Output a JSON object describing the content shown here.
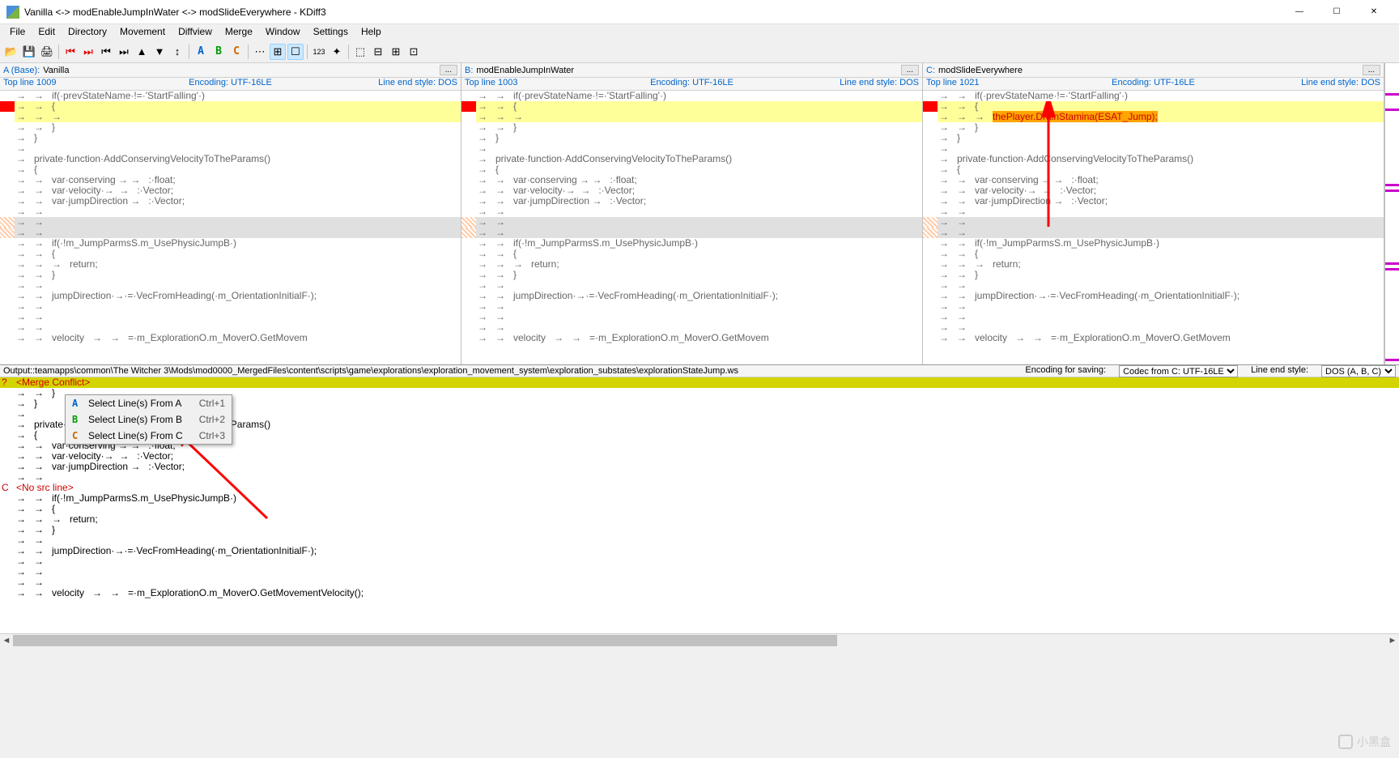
{
  "title": "Vanilla <-> modEnableJumpInWater <-> modSlideEverywhere - KDiff3",
  "menu": [
    "File",
    "Edit",
    "Directory",
    "Movement",
    "Diffview",
    "Merge",
    "Window",
    "Settings",
    "Help"
  ],
  "toolbar_icons": [
    "open",
    "save",
    "print",
    "|",
    "nav1",
    "nav2",
    "nav3",
    "nav4",
    "nav5",
    "nav6",
    "nav7",
    "|",
    "A",
    "B",
    "C",
    "|",
    "toggle1",
    "toggle2",
    "toggle3",
    "|",
    "123",
    "split",
    "|",
    "cfg1",
    "cfg2",
    "cfg3",
    "cfg4"
  ],
  "panes": {
    "A": {
      "label": "A (Base):",
      "name": "Vanilla",
      "topline": "Top line 1009",
      "encoding": "Encoding: UTF-16LE",
      "lineend": "Line end style: DOS"
    },
    "B": {
      "label": "B:",
      "name": "modEnableJumpInWater",
      "topline": "Top line 1003",
      "encoding": "Encoding: UTF-16LE",
      "lineend": "Line end style: DOS"
    },
    "C": {
      "label": "C:",
      "name": "modSlideEverywhere",
      "topline": "Top line 1021",
      "encoding": "Encoding: UTF-16LE",
      "lineend": "Line end style: DOS"
    }
  },
  "codeA": [
    {
      "g": "",
      "c": "→   →   if(·prevStateName·!=·'StartFalling'·)",
      "cls": ""
    },
    {
      "g": "red",
      "c": "→   →   {",
      "cls": "hl-yellow"
    },
    {
      "g": "",
      "c": "→   →   →   ",
      "cls": "hl-yellow"
    },
    {
      "g": "",
      "c": "→   →   }",
      "cls": ""
    },
    {
      "g": "",
      "c": "→   }",
      "cls": ""
    },
    {
      "g": "",
      "c": "→   ",
      "cls": ""
    },
    {
      "g": "",
      "c": "→   private·function·AddConservingVelocityToTheParams()",
      "cls": ""
    },
    {
      "g": "",
      "c": "→   {",
      "cls": ""
    },
    {
      "g": "",
      "c": "→   →   var·conserving → →   :·float;",
      "cls": ""
    },
    {
      "g": "",
      "c": "→   →   var·velocity·→  →   :·Vector;",
      "cls": ""
    },
    {
      "g": "",
      "c": "→   →   var·jumpDirection →   :·Vector;",
      "cls": ""
    },
    {
      "g": "",
      "c": "→   →   ",
      "cls": ""
    },
    {
      "g": "hatch",
      "c": "→   →   ",
      "cls": "hl-gray"
    },
    {
      "g": "hatch",
      "c": "→   →   ",
      "cls": "hl-gray"
    },
    {
      "g": "",
      "c": "→   →   if(·!m_JumpParmsS.m_UsePhysicJumpB·)",
      "cls": ""
    },
    {
      "g": "",
      "c": "→   →   {",
      "cls": ""
    },
    {
      "g": "",
      "c": "→   →   →   return;",
      "cls": ""
    },
    {
      "g": "",
      "c": "→   →   }",
      "cls": ""
    },
    {
      "g": "",
      "c": "→   →   ",
      "cls": ""
    },
    {
      "g": "",
      "c": "→   →   jumpDirection·→·=·VecFromHeading(·m_OrientationInitialF·);",
      "cls": ""
    },
    {
      "g": "",
      "c": "→   →   ",
      "cls": ""
    },
    {
      "g": "",
      "c": "→   →   ",
      "cls": ""
    },
    {
      "g": "",
      "c": "→   →   ",
      "cls": ""
    },
    {
      "g": "",
      "c": "→   →   velocity   →   →   =·m_ExplorationO.m_MoverO.GetMovem",
      "cls": ""
    }
  ],
  "codeC_highlight": "thePlayer.DrainStamina(ESAT_Jump);",
  "output": {
    "path": "Output::teamapps\\common\\The Witcher 3\\Mods\\mod0000_MergedFiles\\content\\scripts\\game\\explorations\\exploration_movement_system\\exploration_substates\\explorationStateJump.ws",
    "encoding_label": "Encoding for saving:",
    "encoding_value": "Codec from C: UTF-16LE",
    "lineend_label": "Line end style:",
    "lineend_value": "DOS (A, B, C)"
  },
  "output_lines": [
    {
      "m": "?",
      "c": "<Merge Conflict>",
      "cls": "conflict-line"
    },
    {
      "m": "",
      "c": "→   →   }",
      "cls": ""
    },
    {
      "m": "",
      "c": "→   }",
      "cls": ""
    },
    {
      "m": "",
      "c": "→   ",
      "cls": ""
    },
    {
      "m": "",
      "c": "→   private·function·AddConservingVelocityToTheParams()",
      "cls": ""
    },
    {
      "m": "",
      "c": "→   {",
      "cls": ""
    },
    {
      "m": "",
      "c": "→   →   var·conserving → →   :·float;",
      "cls": ""
    },
    {
      "m": "",
      "c": "→   →   var·velocity·→  →   :·Vector;",
      "cls": ""
    },
    {
      "m": "",
      "c": "→   →   var·jumpDirection →   :·Vector;",
      "cls": ""
    },
    {
      "m": "",
      "c": "→   →   ",
      "cls": ""
    },
    {
      "m": "C",
      "c": "<No src line>",
      "cls": "txt-red"
    },
    {
      "m": "",
      "c": "→   →   if(·!m_JumpParmsS.m_UsePhysicJumpB·)",
      "cls": ""
    },
    {
      "m": "",
      "c": "→   →   {",
      "cls": ""
    },
    {
      "m": "",
      "c": "→   →   →   return;",
      "cls": ""
    },
    {
      "m": "",
      "c": "→   →   }",
      "cls": ""
    },
    {
      "m": "",
      "c": "→   →   ",
      "cls": ""
    },
    {
      "m": "",
      "c": "→   →   jumpDirection·→·=·VecFromHeading(·m_OrientationInitialF·);",
      "cls": ""
    },
    {
      "m": "",
      "c": "→   →   ",
      "cls": ""
    },
    {
      "m": "",
      "c": "→   →   ",
      "cls": ""
    },
    {
      "m": "",
      "c": "→   →   ",
      "cls": ""
    },
    {
      "m": "",
      "c": "→   →   velocity   →   →   =·m_ExplorationO.m_MoverO.GetMovementVelocity();",
      "cls": ""
    }
  ],
  "context_menu": [
    {
      "icon": "A",
      "iconClass": "tb-a",
      "label": "Select Line(s) From A",
      "shortcut": "Ctrl+1"
    },
    {
      "icon": "B",
      "iconClass": "tb-b",
      "label": "Select Line(s) From B",
      "shortcut": "Ctrl+2"
    },
    {
      "icon": "C",
      "iconClass": "tb-c",
      "label": "Select Line(s) From C",
      "shortcut": "Ctrl+3"
    }
  ],
  "watermark": "小黑盒"
}
